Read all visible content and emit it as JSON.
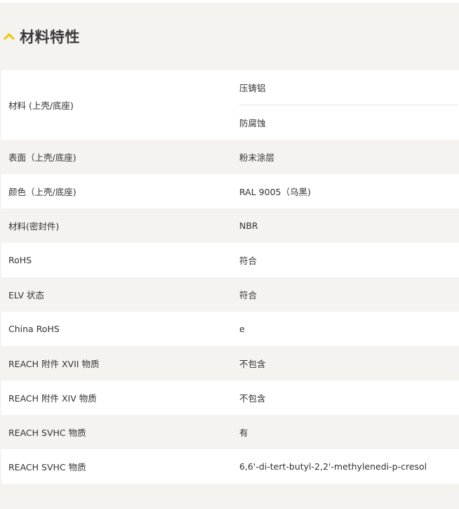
{
  "section": {
    "title": "材料特性",
    "icon": "chevron-up-icon",
    "accent_color": "#f5c400"
  },
  "rows": [
    {
      "name": "材料 (上壳/底座)",
      "values": [
        "压铸铝",
        "防腐蚀"
      ]
    },
    {
      "name": "表面（上壳/底座)",
      "values": [
        "粉末涂层"
      ]
    },
    {
      "name": "颜色（上壳/底座)",
      "values": [
        "RAL 9005（乌黑)"
      ]
    },
    {
      "name": "材料(密封件)",
      "values": [
        "NBR"
      ]
    },
    {
      "name": "RoHS",
      "values": [
        "符合"
      ]
    },
    {
      "name": "ELV 状态",
      "values": [
        "符合"
      ]
    },
    {
      "name": "China RoHS",
      "values": [
        "e"
      ]
    },
    {
      "name": "REACH 附件 XVII 物质",
      "values": [
        "不包含"
      ]
    },
    {
      "name": "REACH 附件 XIV 物质",
      "values": [
        "不包含"
      ]
    },
    {
      "name": "REACH SVHC 物质",
      "values": [
        "有"
      ]
    },
    {
      "name": "REACH SVHC 物质",
      "values": [
        "6,6'-di-tert-butyl-2,2'-methylenedi-p-cresol"
      ]
    }
  ]
}
